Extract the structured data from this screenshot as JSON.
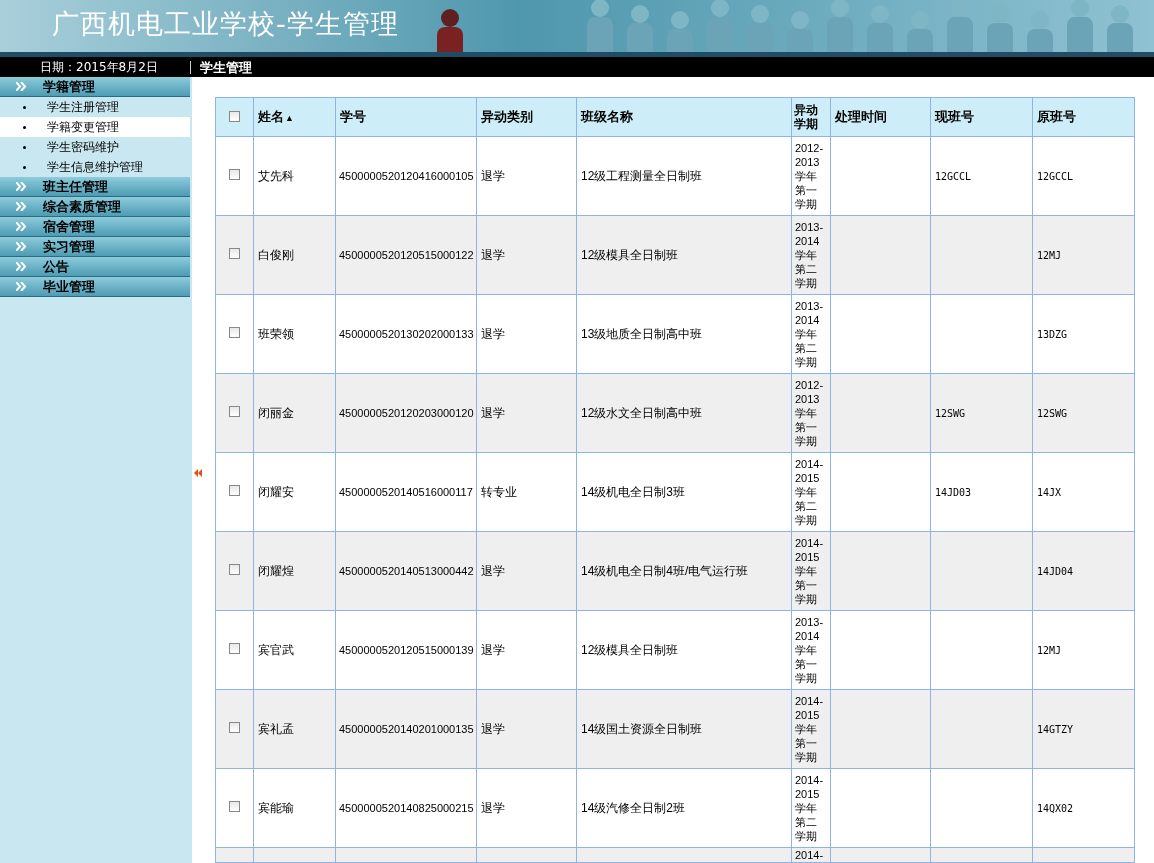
{
  "header": {
    "title": "广西机电工业学校-学生管理"
  },
  "info_bar": {
    "date": "日期：2015年8月2日",
    "section": "学生管理"
  },
  "sidebar": {
    "items": [
      {
        "label": "学籍管理",
        "children": [
          {
            "label": "学生注册管理",
            "selected": false
          },
          {
            "label": "学籍变更管理",
            "selected": true
          },
          {
            "label": "学生密码维护",
            "selected": false
          },
          {
            "label": "学生信息维护管理",
            "selected": false
          }
        ]
      },
      {
        "label": "班主任管理"
      },
      {
        "label": "综合素质管理"
      },
      {
        "label": "宿舍管理"
      },
      {
        "label": "实习管理"
      },
      {
        "label": "公告"
      },
      {
        "label": "毕业管理"
      }
    ]
  },
  "table": {
    "select_all": {
      "checked": false
    },
    "columns": [
      {
        "label": "姓名",
        "sort_indicator": "▲"
      },
      {
        "label": "学号"
      },
      {
        "label": "异动类别"
      },
      {
        "label": "班级名称"
      },
      {
        "label": "异动学期"
      },
      {
        "label": "处理时间"
      },
      {
        "label": "现班号"
      },
      {
        "label": "原班号"
      }
    ],
    "rows": [
      {
        "checked": false,
        "name": "艾先科",
        "student_id": "4500000520120416000105",
        "change_type": "退学",
        "class_name": "12级工程测量全日制班",
        "period": "2012-2013学年第一学期",
        "current_class": "12GCCL",
        "original_class": "12GCCL"
      },
      {
        "checked": false,
        "name": "白俊刚",
        "student_id": "4500000520120515000122",
        "change_type": "退学",
        "class_name": "12级模具全日制班",
        "period": "2013-2014学年第二学期",
        "original_class": "12MJ"
      },
      {
        "checked": false,
        "name": "班荣领",
        "student_id": "4500000520130202000133",
        "change_type": "退学",
        "class_name": "13级地质全日制高中班",
        "period": "2013-2014学年第二学期",
        "original_class": "13DZG"
      },
      {
        "checked": false,
        "name": "闭丽金",
        "student_id": "4500000520120203000120",
        "change_type": "退学",
        "class_name": "12级水文全日制高中班",
        "period": "2012-2013学年第一学期",
        "current_class": "12SWG",
        "original_class": "12SWG"
      },
      {
        "checked": false,
        "name": "闭耀安",
        "student_id": "4500000520140516000117",
        "change_type": "转专业",
        "class_name": "14级机电全日制3班",
        "period": "2014-2015学年第二学期",
        "current_class": "14JD03",
        "original_class": "14JX"
      },
      {
        "checked": false,
        "name": "闭耀煌",
        "student_id": "4500000520140513000442",
        "change_type": "退学",
        "class_name": "14级机电全日制4班/电气运行班",
        "period": "2014-2015学年第一学期",
        "original_class": "14JD04"
      },
      {
        "checked": false,
        "name": "宾官武",
        "student_id": "4500000520120515000139",
        "change_type": "退学",
        "class_name": "12级模具全日制班",
        "period": "2013-2014学年第一学期",
        "original_class": "12MJ"
      },
      {
        "checked": false,
        "name": "宾礼孟",
        "student_id": "4500000520140201000135",
        "change_type": "退学",
        "class_name": "14级国土资源全日制班",
        "period": "2014-2015学年第一学期",
        "original_class": "14GTZY"
      },
      {
        "checked": false,
        "name": "宾能瑜",
        "student_id": "4500000520140825000215",
        "change_type": "退学",
        "class_name": "14级汽修全日制2班",
        "period": "2014-2015学年第二学期",
        "original_class": "14QX02"
      },
      {
        "period": "2014-"
      }
    ]
  }
}
